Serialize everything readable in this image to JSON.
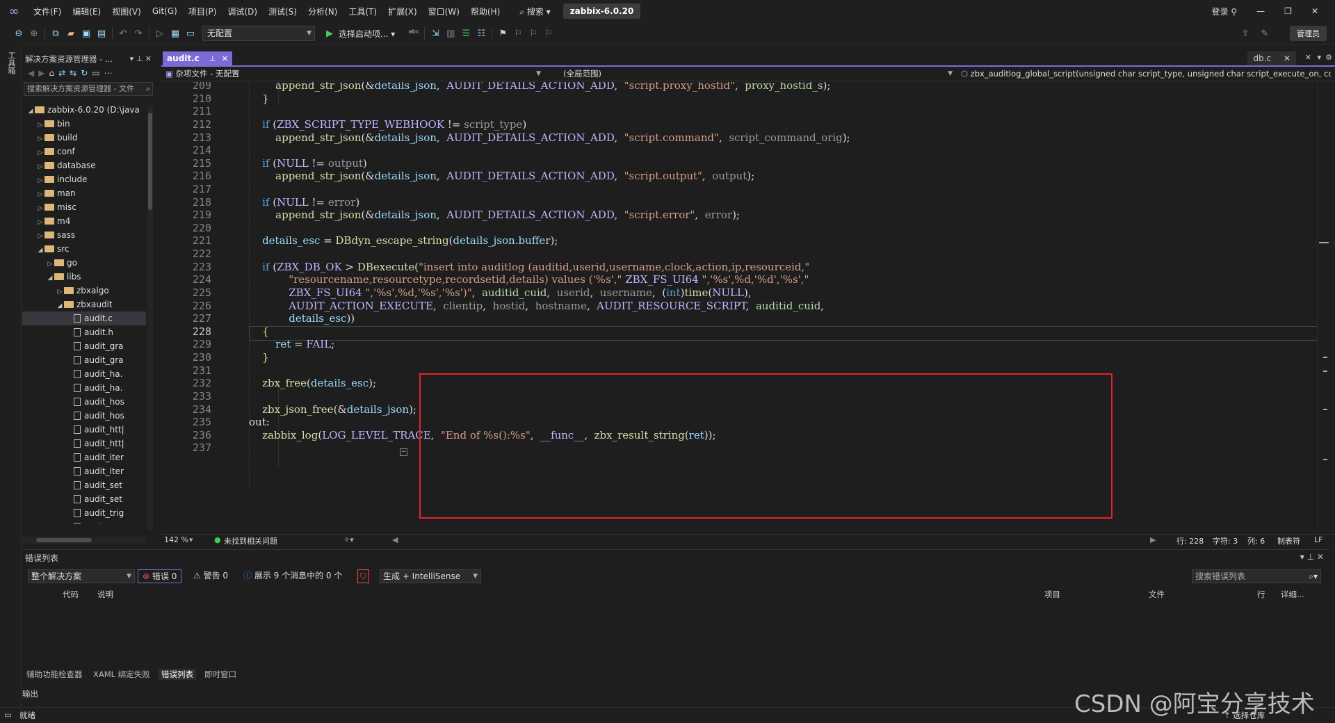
{
  "menubar": {
    "menus": [
      "文件(F)",
      "编辑(E)",
      "视图(V)",
      "Git(G)",
      "项目(P)",
      "调试(D)",
      "测试(S)",
      "分析(N)",
      "工具(T)",
      "扩展(X)",
      "窗口(W)",
      "帮助(H)"
    ],
    "search": "搜索",
    "solution_name": "zabbix-6.0.20",
    "login": "登录"
  },
  "toolbar": {
    "config_combo": "无配置",
    "start_item": "选择启动项...",
    "admin": "管理员"
  },
  "left_strip": {
    "label": "工具箱"
  },
  "solution_explorer": {
    "title": "解决方案资源管理器 - ...",
    "search_placeholder": "搜索解决方案资源管理器 - 文件",
    "items": [
      {
        "label": "zabbix-6.0.20 (D:\\java",
        "depth": 0,
        "kind": "folder",
        "expander": "◢"
      },
      {
        "label": "bin",
        "depth": 1,
        "kind": "folder",
        "expander": "▷"
      },
      {
        "label": "build",
        "depth": 1,
        "kind": "folder",
        "expander": "▷"
      },
      {
        "label": "conf",
        "depth": 1,
        "kind": "folder",
        "expander": "▷"
      },
      {
        "label": "database",
        "depth": 1,
        "kind": "folder",
        "expander": "▷"
      },
      {
        "label": "include",
        "depth": 1,
        "kind": "folder",
        "expander": "▷"
      },
      {
        "label": "man",
        "depth": 1,
        "kind": "folder",
        "expander": "▷"
      },
      {
        "label": "misc",
        "depth": 1,
        "kind": "folder",
        "expander": "▷"
      },
      {
        "label": "m4",
        "depth": 1,
        "kind": "folder",
        "expander": "▷"
      },
      {
        "label": "sass",
        "depth": 1,
        "kind": "folder",
        "expander": "▷"
      },
      {
        "label": "src",
        "depth": 1,
        "kind": "folder",
        "expander": "◢"
      },
      {
        "label": "go",
        "depth": 2,
        "kind": "folder",
        "expander": "▷"
      },
      {
        "label": "libs",
        "depth": 2,
        "kind": "folder",
        "expander": "◢"
      },
      {
        "label": "zbxalgo",
        "depth": 3,
        "kind": "folder",
        "expander": "▷"
      },
      {
        "label": "zbxaudit",
        "depth": 3,
        "kind": "folder",
        "expander": "◢"
      },
      {
        "label": "audit.c",
        "depth": 4,
        "kind": "file",
        "expander": "",
        "selected": true
      },
      {
        "label": "audit.h",
        "depth": 4,
        "kind": "file",
        "expander": ""
      },
      {
        "label": "audit_gra",
        "depth": 4,
        "kind": "file",
        "expander": ""
      },
      {
        "label": "audit_gra",
        "depth": 4,
        "kind": "file",
        "expander": ""
      },
      {
        "label": "audit_ha.",
        "depth": 4,
        "kind": "file",
        "expander": ""
      },
      {
        "label": "audit_ha.",
        "depth": 4,
        "kind": "file",
        "expander": ""
      },
      {
        "label": "audit_hos",
        "depth": 4,
        "kind": "file",
        "expander": ""
      },
      {
        "label": "audit_hos",
        "depth": 4,
        "kind": "file",
        "expander": ""
      },
      {
        "label": "audit_htt|",
        "depth": 4,
        "kind": "file",
        "expander": ""
      },
      {
        "label": "audit_htt|",
        "depth": 4,
        "kind": "file",
        "expander": ""
      },
      {
        "label": "audit_iter",
        "depth": 4,
        "kind": "file",
        "expander": ""
      },
      {
        "label": "audit_iter",
        "depth": 4,
        "kind": "file",
        "expander": ""
      },
      {
        "label": "audit_set",
        "depth": 4,
        "kind": "file",
        "expander": ""
      },
      {
        "label": "audit_set",
        "depth": 4,
        "kind": "file",
        "expander": ""
      },
      {
        "label": "audit_trig",
        "depth": 4,
        "kind": "file",
        "expander": ""
      },
      {
        "label": "audit_trig",
        "depth": 4,
        "kind": "file",
        "expander": ""
      }
    ]
  },
  "editor": {
    "active_tab": "audit.c",
    "other_tab": "db.c",
    "nav_project": "杂项文件 - 无配置",
    "nav_scope": "(全局范围)",
    "nav_function": "zbx_auditlog_global_script(unsigned char script_type, unsigned char script_execute_on, cc",
    "current_line": 228,
    "lines": [
      {
        "n": 209,
        "tokens": [
          [
            "",
            "        "
          ],
          [
            "fn",
            "append_str_json"
          ],
          [
            "",
            "(&"
          ],
          [
            "vr",
            "details_json"
          ],
          [
            "",
            ",  "
          ],
          [
            "mc",
            "AUDIT_DETAILS_ACTION_ADD"
          ],
          [
            "",
            ",  "
          ],
          [
            "str",
            "\"script.proxy_hostid\""
          ],
          [
            "",
            ",  "
          ],
          [
            "gv",
            "proxy_hostid_s"
          ],
          [
            "",
            ");"
          ]
        ]
      },
      {
        "n": 210,
        "tokens": [
          [
            "",
            "    }"
          ]
        ]
      },
      {
        "n": 211,
        "tokens": []
      },
      {
        "n": 212,
        "tokens": [
          [
            "",
            "    "
          ],
          [
            "kw",
            "if"
          ],
          [
            "",
            " ("
          ],
          [
            "mc",
            "ZBX_SCRIPT_TYPE_WEBHOOK"
          ],
          [
            "",
            " != "
          ],
          [
            "gr",
            "script_type"
          ],
          [
            "",
            ")"
          ]
        ]
      },
      {
        "n": 213,
        "tokens": [
          [
            "",
            "        "
          ],
          [
            "fn",
            "append_str_json"
          ],
          [
            "",
            "(&"
          ],
          [
            "vr",
            "details_json"
          ],
          [
            "",
            ",  "
          ],
          [
            "mc",
            "AUDIT_DETAILS_ACTION_ADD"
          ],
          [
            "",
            ",  "
          ],
          [
            "str",
            "\"script.command\""
          ],
          [
            "",
            ",  "
          ],
          [
            "gr",
            "script_command_orig"
          ],
          [
            "",
            ");"
          ]
        ]
      },
      {
        "n": 214,
        "tokens": []
      },
      {
        "n": 215,
        "tokens": [
          [
            "",
            "    "
          ],
          [
            "kw",
            "if"
          ],
          [
            "",
            " ("
          ],
          [
            "mc",
            "NULL"
          ],
          [
            "",
            " != "
          ],
          [
            "gr",
            "output"
          ],
          [
            "",
            ")"
          ]
        ]
      },
      {
        "n": 216,
        "tokens": [
          [
            "",
            "        "
          ],
          [
            "fn",
            "append_str_json"
          ],
          [
            "",
            "(&"
          ],
          [
            "vr",
            "details_json"
          ],
          [
            "",
            ",  "
          ],
          [
            "mc",
            "AUDIT_DETAILS_ACTION_ADD"
          ],
          [
            "",
            ",  "
          ],
          [
            "str",
            "\"script.output\""
          ],
          [
            "",
            ",  "
          ],
          [
            "gr",
            "output"
          ],
          [
            "",
            ");"
          ]
        ]
      },
      {
        "n": 217,
        "tokens": []
      },
      {
        "n": 218,
        "tokens": [
          [
            "",
            "    "
          ],
          [
            "kw",
            "if"
          ],
          [
            "",
            " ("
          ],
          [
            "mc",
            "NULL"
          ],
          [
            "",
            " != "
          ],
          [
            "gr",
            "error"
          ],
          [
            "",
            ")"
          ]
        ]
      },
      {
        "n": 219,
        "tokens": [
          [
            "",
            "        "
          ],
          [
            "fn",
            "append_str_json"
          ],
          [
            "",
            "(&"
          ],
          [
            "vr",
            "details_json"
          ],
          [
            "",
            ",  "
          ],
          [
            "mc",
            "AUDIT_DETAILS_ACTION_ADD"
          ],
          [
            "",
            ",  "
          ],
          [
            "str",
            "\"script.error\""
          ],
          [
            "",
            ",  "
          ],
          [
            "gr",
            "error"
          ],
          [
            "",
            ");"
          ]
        ]
      },
      {
        "n": 220,
        "tokens": []
      },
      {
        "n": 221,
        "tokens": [
          [
            "",
            "    "
          ],
          [
            "vr",
            "details_esc"
          ],
          [
            "",
            " = "
          ],
          [
            "fn",
            "DBdyn_escape_string"
          ],
          [
            "",
            "("
          ],
          [
            "vr",
            "details_json"
          ],
          [
            "",
            "."
          ],
          [
            "vr",
            "buffer"
          ],
          [
            "",
            ");"
          ]
        ]
      },
      {
        "n": 222,
        "tokens": []
      },
      {
        "n": 223,
        "tokens": [
          [
            "",
            "    "
          ],
          [
            "kw",
            "if"
          ],
          [
            "",
            " ("
          ],
          [
            "mc",
            "ZBX_DB_OK"
          ],
          [
            "",
            " > "
          ],
          [
            "fn",
            "DBexecute"
          ],
          [
            "",
            "("
          ],
          [
            "str",
            "\"insert into auditlog (auditid,userid,username,clock,action,ip,resourceid,\""
          ]
        ]
      },
      {
        "n": 224,
        "tokens": [
          [
            "",
            "            "
          ],
          [
            "str",
            "\"resourcename,resourcetype,recordsetid,details) values ('%s',\""
          ],
          [
            "",
            " "
          ],
          [
            "mc",
            "ZBX_FS_UI64"
          ],
          [
            "",
            " "
          ],
          [
            "str",
            "\",'%s',%d,'%d','%s',\""
          ]
        ]
      },
      {
        "n": 225,
        "tokens": [
          [
            "",
            "            "
          ],
          [
            "mc",
            "ZBX_FS_UI64"
          ],
          [
            "",
            " "
          ],
          [
            "str",
            "\",'%s',%d,'%s','%s')\""
          ],
          [
            "",
            ",  "
          ],
          [
            "gv",
            "auditid_cuid"
          ],
          [
            "",
            ",  "
          ],
          [
            "gr",
            "userid"
          ],
          [
            "",
            ",  "
          ],
          [
            "gr",
            "username"
          ],
          [
            "",
            ",  ("
          ],
          [
            "kw",
            "int"
          ],
          [
            "",
            ")"
          ],
          [
            "fn",
            "time"
          ],
          [
            "",
            "("
          ],
          [
            "mc",
            "NULL"
          ],
          [
            "",
            "),"
          ]
        ]
      },
      {
        "n": 226,
        "tokens": [
          [
            "",
            "            "
          ],
          [
            "mc",
            "AUDIT_ACTION_EXECUTE"
          ],
          [
            "",
            ",  "
          ],
          [
            "gr",
            "clientip"
          ],
          [
            "",
            ",  "
          ],
          [
            "gr",
            "hostid"
          ],
          [
            "",
            ",  "
          ],
          [
            "gr",
            "hostname"
          ],
          [
            "",
            ",  "
          ],
          [
            "mc",
            "AUDIT_RESOURCE_SCRIPT"
          ],
          [
            "",
            ",  "
          ],
          [
            "gv",
            "auditid_cuid"
          ],
          [
            "",
            ","
          ]
        ]
      },
      {
        "n": 227,
        "tokens": [
          [
            "",
            "            "
          ],
          [
            "vr",
            "details_esc"
          ],
          [
            "",
            "))"
          ]
        ]
      },
      {
        "n": 228,
        "tokens": [
          [
            "",
            "    "
          ],
          [
            "sp",
            "{"
          ]
        ]
      },
      {
        "n": 229,
        "tokens": [
          [
            "",
            "        "
          ],
          [
            "vr",
            "ret"
          ],
          [
            "",
            " = "
          ],
          [
            "mc",
            "FAIL"
          ],
          [
            "",
            ";"
          ]
        ]
      },
      {
        "n": 230,
        "tokens": [
          [
            "",
            "    "
          ],
          [
            "sp",
            "}"
          ]
        ]
      },
      {
        "n": 231,
        "tokens": []
      },
      {
        "n": 232,
        "tokens": [
          [
            "",
            "    "
          ],
          [
            "fn",
            "zbx_free"
          ],
          [
            "",
            "("
          ],
          [
            "vr",
            "details_esc"
          ],
          [
            "",
            ");"
          ]
        ]
      },
      {
        "n": 233,
        "tokens": []
      },
      {
        "n": 234,
        "tokens": [
          [
            "",
            "    "
          ],
          [
            "fn",
            "zbx_json_free"
          ],
          [
            "",
            "(&"
          ],
          [
            "vr",
            "details_json"
          ],
          [
            "",
            ");"
          ]
        ]
      },
      {
        "n": 235,
        "tokens": [
          [
            "",
            "out:"
          ]
        ]
      },
      {
        "n": 236,
        "tokens": [
          [
            "",
            "    "
          ],
          [
            "fn",
            "zabbix_log"
          ],
          [
            "",
            "("
          ],
          [
            "mc",
            "LOG_LEVEL_TRACE"
          ],
          [
            "",
            ",  "
          ],
          [
            "str",
            "\"End of %s():%s\""
          ],
          [
            "",
            ",  "
          ],
          [
            "mc",
            "__func__"
          ],
          [
            "",
            ",  "
          ],
          [
            "fn",
            "zbx_result_string"
          ],
          [
            "",
            "("
          ],
          [
            "vr",
            "ret"
          ],
          [
            "",
            "));"
          ]
        ]
      },
      {
        "n": 237,
        "tokens": []
      }
    ]
  },
  "editor_status": {
    "zoom": "142 %",
    "issues": "未找到相关问题",
    "row": "行: 228",
    "char": "字符: 3",
    "col": "列: 6",
    "tabs": "制表符",
    "eol": "LF"
  },
  "error_list": {
    "title": "错误列表",
    "scope": "整个解决方案",
    "errors": "错误 0",
    "warnings": "警告 0",
    "messages": "展示 9 个消息中的 0 个",
    "build_filter": "生成 + IntelliSense",
    "search_placeholder": "搜索错误列表",
    "columns": {
      "code": "代码",
      "desc": "说明",
      "project": "项目",
      "file": "文件",
      "line": "行",
      "detail": "详细..."
    }
  },
  "bottom_tabs": [
    "辅助功能检查器",
    "XAML 绑定失败",
    "错误列表",
    "即时窗口"
  ],
  "output_label": "输出",
  "status": {
    "ready": "就绪",
    "source_control": "选择仓库"
  },
  "watermark": "CSDN @阿宝分享技术"
}
